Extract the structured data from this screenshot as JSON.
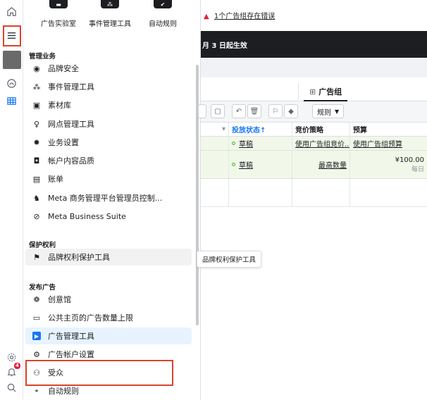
{
  "rail": {
    "icons": [
      "home-icon",
      "menu-icon",
      "avatar",
      "dashboard-icon",
      "table-icon",
      "settings-icon",
      "notification-icon",
      "search-icon"
    ],
    "notif_count": "4"
  },
  "menu": {
    "top_tools": [
      {
        "label": "广告实验室"
      },
      {
        "label": "事件管理工具"
      },
      {
        "label": "自动规则"
      }
    ],
    "sections": {
      "manage": "管理业务",
      "protect": "保护权利",
      "publish": "发布广告"
    },
    "manage_items": [
      {
        "label": "品牌安全",
        "icon": "shield-icon"
      },
      {
        "label": "事件管理工具",
        "icon": "network-icon"
      },
      {
        "label": "素材库",
        "icon": "photo-library-icon"
      },
      {
        "label": "网点管理工具",
        "icon": "location-pin-icon"
      },
      {
        "label": "业务设置",
        "icon": "gear-icon"
      },
      {
        "label": "帐户内容品质",
        "icon": "quality-shield-icon"
      },
      {
        "label": "账单",
        "icon": "bill-icon"
      },
      {
        "label": "Meta 商务管理平台管理员控制...",
        "icon": "admin-people-icon"
      },
      {
        "label": "Meta Business Suite",
        "icon": "meta-suite-icon"
      }
    ],
    "protect_items": [
      {
        "label": "品牌权利保护工具",
        "icon": "flag-icon"
      }
    ],
    "publish_items": [
      {
        "label": "创意馆",
        "icon": "palette-icon"
      },
      {
        "label": "公共主页的广告数量上限",
        "icon": "page-limit-icon"
      },
      {
        "label": "广告管理工具",
        "icon": "ads-manager-icon"
      },
      {
        "label": "广告帐户设置",
        "icon": "account-settings-icon"
      },
      {
        "label": "受众",
        "icon": "audience-icon"
      },
      {
        "label": "自动规则",
        "icon": "automated-rules-icon"
      }
    ]
  },
  "main": {
    "error_text": "1个广告组存在错误",
    "notice_text": "月 3 日起生效",
    "tab_label": "广告组",
    "rules_label": "规则",
    "columns": [
      "投放状态↑",
      "竞价策略",
      "预算"
    ],
    "rows": [
      {
        "status": "草稿",
        "bid": "使用广告组竞价...",
        "budget": "使用广告组预算",
        "budget_sub": ""
      },
      {
        "status": "草稿",
        "bid": "最高数量",
        "budget": "¥100.00",
        "budget_sub": "每日"
      }
    ],
    "tooltip": "品牌权利保护工具"
  },
  "colors": {
    "highlight_box": "#d9432b",
    "active_item_bg": "#e7f3ff",
    "accent_blue": "#1877f2",
    "draft_green": "#42b72a",
    "row_green": "#f1f8e9"
  }
}
